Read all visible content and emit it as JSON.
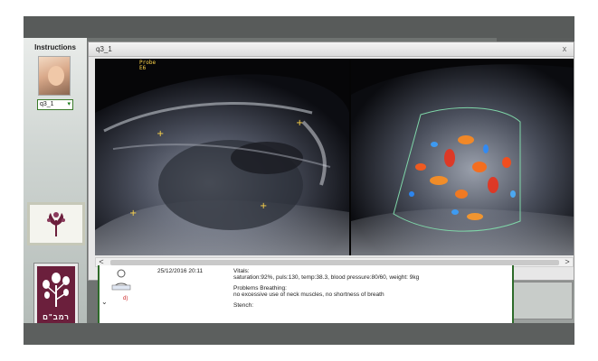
{
  "instructions": {
    "title": "Instructions",
    "case_select_value": "q3_1"
  },
  "brand": {
    "text": "רמב\"ם"
  },
  "popup": {
    "title": "q3_1",
    "close_label": "x",
    "marker_label_line1": "Probe",
    "marker_label_line2": "E6"
  },
  "scrollbar": {
    "left_arrow": "<",
    "right_arrow": ">"
  },
  "note": {
    "id_label": "d)",
    "date": "25/12/2016 20:11",
    "vitals_heading": "Vitals:",
    "vitals_text": "saturation:92%, puls:130, temp:38.3, blood pressure:80/60, weight: 9kg",
    "breathing_heading": "Problems Breathing:",
    "breathing_text": "no excessive use of neck muscles, no shortness of breath",
    "stench_heading": "Stench:"
  },
  "colors": {
    "accent_green": "#2e6b2a",
    "brand_maroon": "#6b1f3c",
    "marker_yellow": "#ffd54a"
  }
}
